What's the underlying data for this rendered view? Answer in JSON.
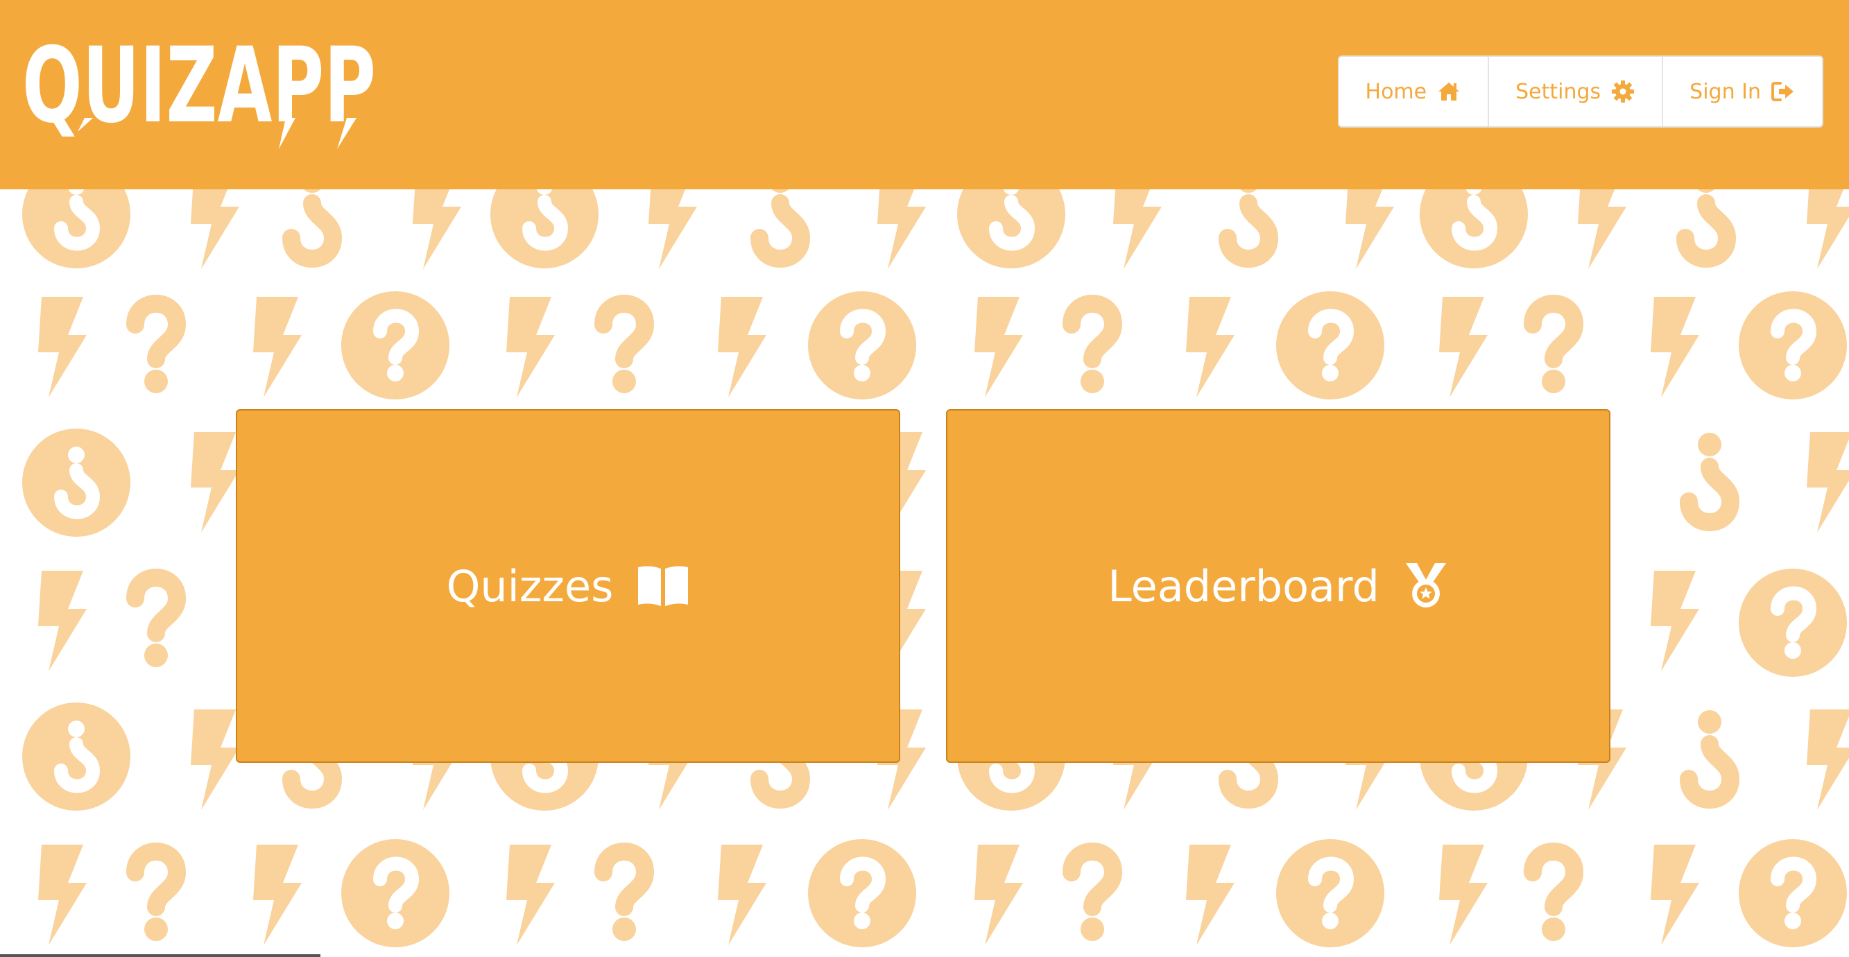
{
  "app": {
    "logo_text": "QUIZAPP"
  },
  "nav": {
    "items": [
      {
        "label": "Home",
        "icon": "home-icon"
      },
      {
        "label": "Settings",
        "icon": "gear-icon"
      },
      {
        "label": "Sign In",
        "icon": "sign-in-icon"
      }
    ]
  },
  "cards": {
    "quizzes": {
      "label": "Quizzes",
      "icon": "book-open-icon"
    },
    "leaderboard": {
      "label": "Leaderboard",
      "icon": "medal-icon"
    }
  },
  "colors": {
    "brand": "#f4a93d",
    "pattern": "#f9d29c",
    "white": "#ffffff"
  }
}
